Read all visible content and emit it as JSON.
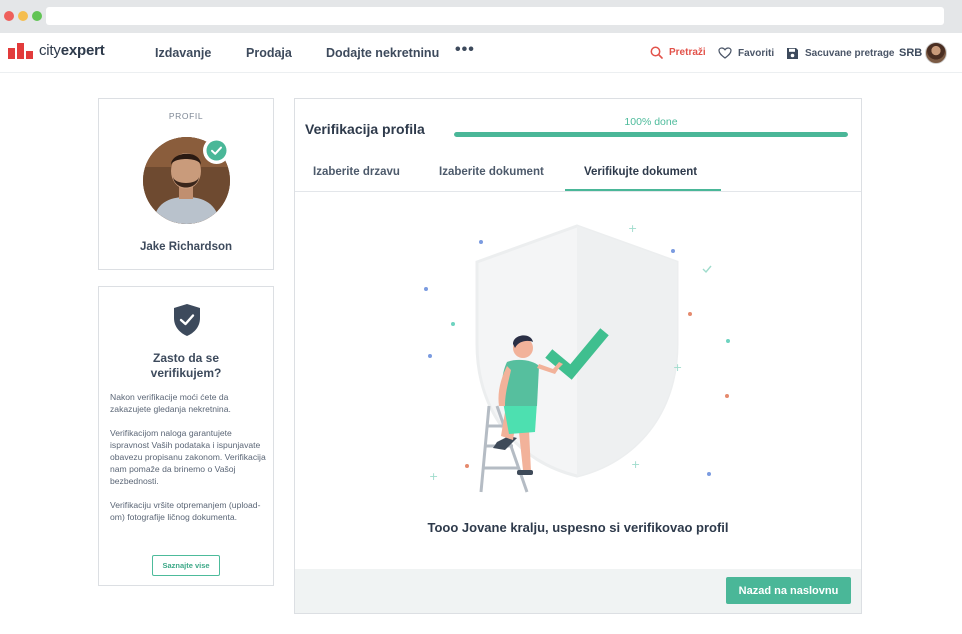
{
  "nav": {
    "logo_prefix": "city",
    "logo_suffix": "expert",
    "links": [
      "Izdavanje",
      "Prodaja",
      "Dodajte nekretninu"
    ],
    "more": "•••",
    "search": "Pretraži",
    "favorites": "Favoriti",
    "saved_searches": "Sacuvane pretrage",
    "language": "SRB"
  },
  "profile": {
    "label": "PROFIL",
    "name": "Jake Richardson"
  },
  "why": {
    "title": "Zasto da se verifikujem?",
    "paragraphs": [
      "Nakon verifikacije moći ćete da zakazujete gledanja nekretnina.",
      "Verifikacijom naloga garantujete ispravnost Vaših podataka i ispunjavate obavezu propisanu zakonom. Verifikacija nam pomaže da brinemo o Vašoj bezbednosti.",
      "Verifikaciju vršite otpremanjem (upload-om) fotografije ličnog dokumenta."
    ],
    "button": "Saznajte vise"
  },
  "verification": {
    "title": "Verifikacija profila",
    "progress_label": "100% done",
    "progress": 1.0,
    "tabs": [
      "Izaberite drzavu",
      "Izaberite dokument",
      "Verifikujte dokument"
    ],
    "active_tab": "Verifikujte dokument",
    "success_message": "Tooo Jovane kralju, uspesno si verifikovao profil",
    "back_button": "Nazad na naslovnu"
  },
  "colors": {
    "accent": "#4ab798",
    "brand_red": "#e23b3b",
    "text_dark": "#2e3a4b"
  }
}
